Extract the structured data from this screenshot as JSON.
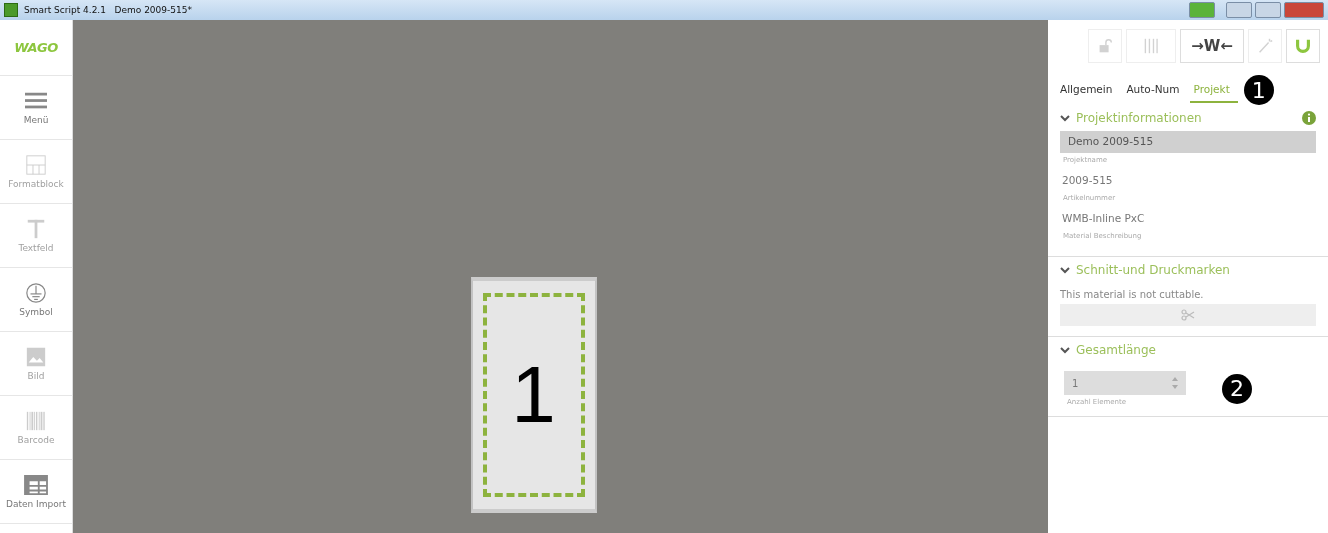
{
  "window": {
    "title": "Smart Script 4.2.1   Demo 2009-515*"
  },
  "sidebar": {
    "logo": "WAGO",
    "items": [
      {
        "kind": "menu",
        "label": "Menü",
        "disabled": false
      },
      {
        "kind": "formatblock",
        "label": "Formatblock",
        "disabled": true
      },
      {
        "kind": "text",
        "label": "Textfeld",
        "disabled": true
      },
      {
        "kind": "symbol",
        "label": "Symbol",
        "disabled": false
      },
      {
        "kind": "image",
        "label": "Bild",
        "disabled": true
      },
      {
        "kind": "barcode",
        "label": "Barcode",
        "disabled": true
      },
      {
        "kind": "table",
        "label": "Daten Import",
        "disabled": false
      }
    ]
  },
  "canvas": {
    "label_text": "1"
  },
  "toolbar": [
    {
      "kind": "lock",
      "disabled": true
    },
    {
      "kind": "bars",
      "disabled": true
    },
    {
      "kind": "fit",
      "label": "→W←",
      "disabled": false
    },
    {
      "kind": "wand",
      "disabled": true
    },
    {
      "kind": "magnet",
      "disabled": false
    }
  ],
  "tabs": [
    {
      "label": "Allgemein",
      "selected": false
    },
    {
      "label": "Auto-Num",
      "selected": false
    },
    {
      "label": "Projekt",
      "selected": true
    }
  ],
  "callouts": [
    "1",
    "2"
  ],
  "sections": [
    {
      "title": "Projektinformationen",
      "fields": [
        {
          "value": "Demo 2009-515",
          "label": "Projektname",
          "filled": true
        },
        {
          "value": "2009-515",
          "label": "Artikelnummer",
          "filled": false
        },
        {
          "value": "WMB-Inline PxC",
          "label": "Material Beschreibung",
          "filled": false
        }
      ]
    },
    {
      "title": "Schnitt-und Druckmarken",
      "note": "This material is not cuttable."
    },
    {
      "title": "Gesamtlänge",
      "spinner": {
        "value": "1",
        "label": "Anzahl Elemente"
      }
    }
  ]
}
